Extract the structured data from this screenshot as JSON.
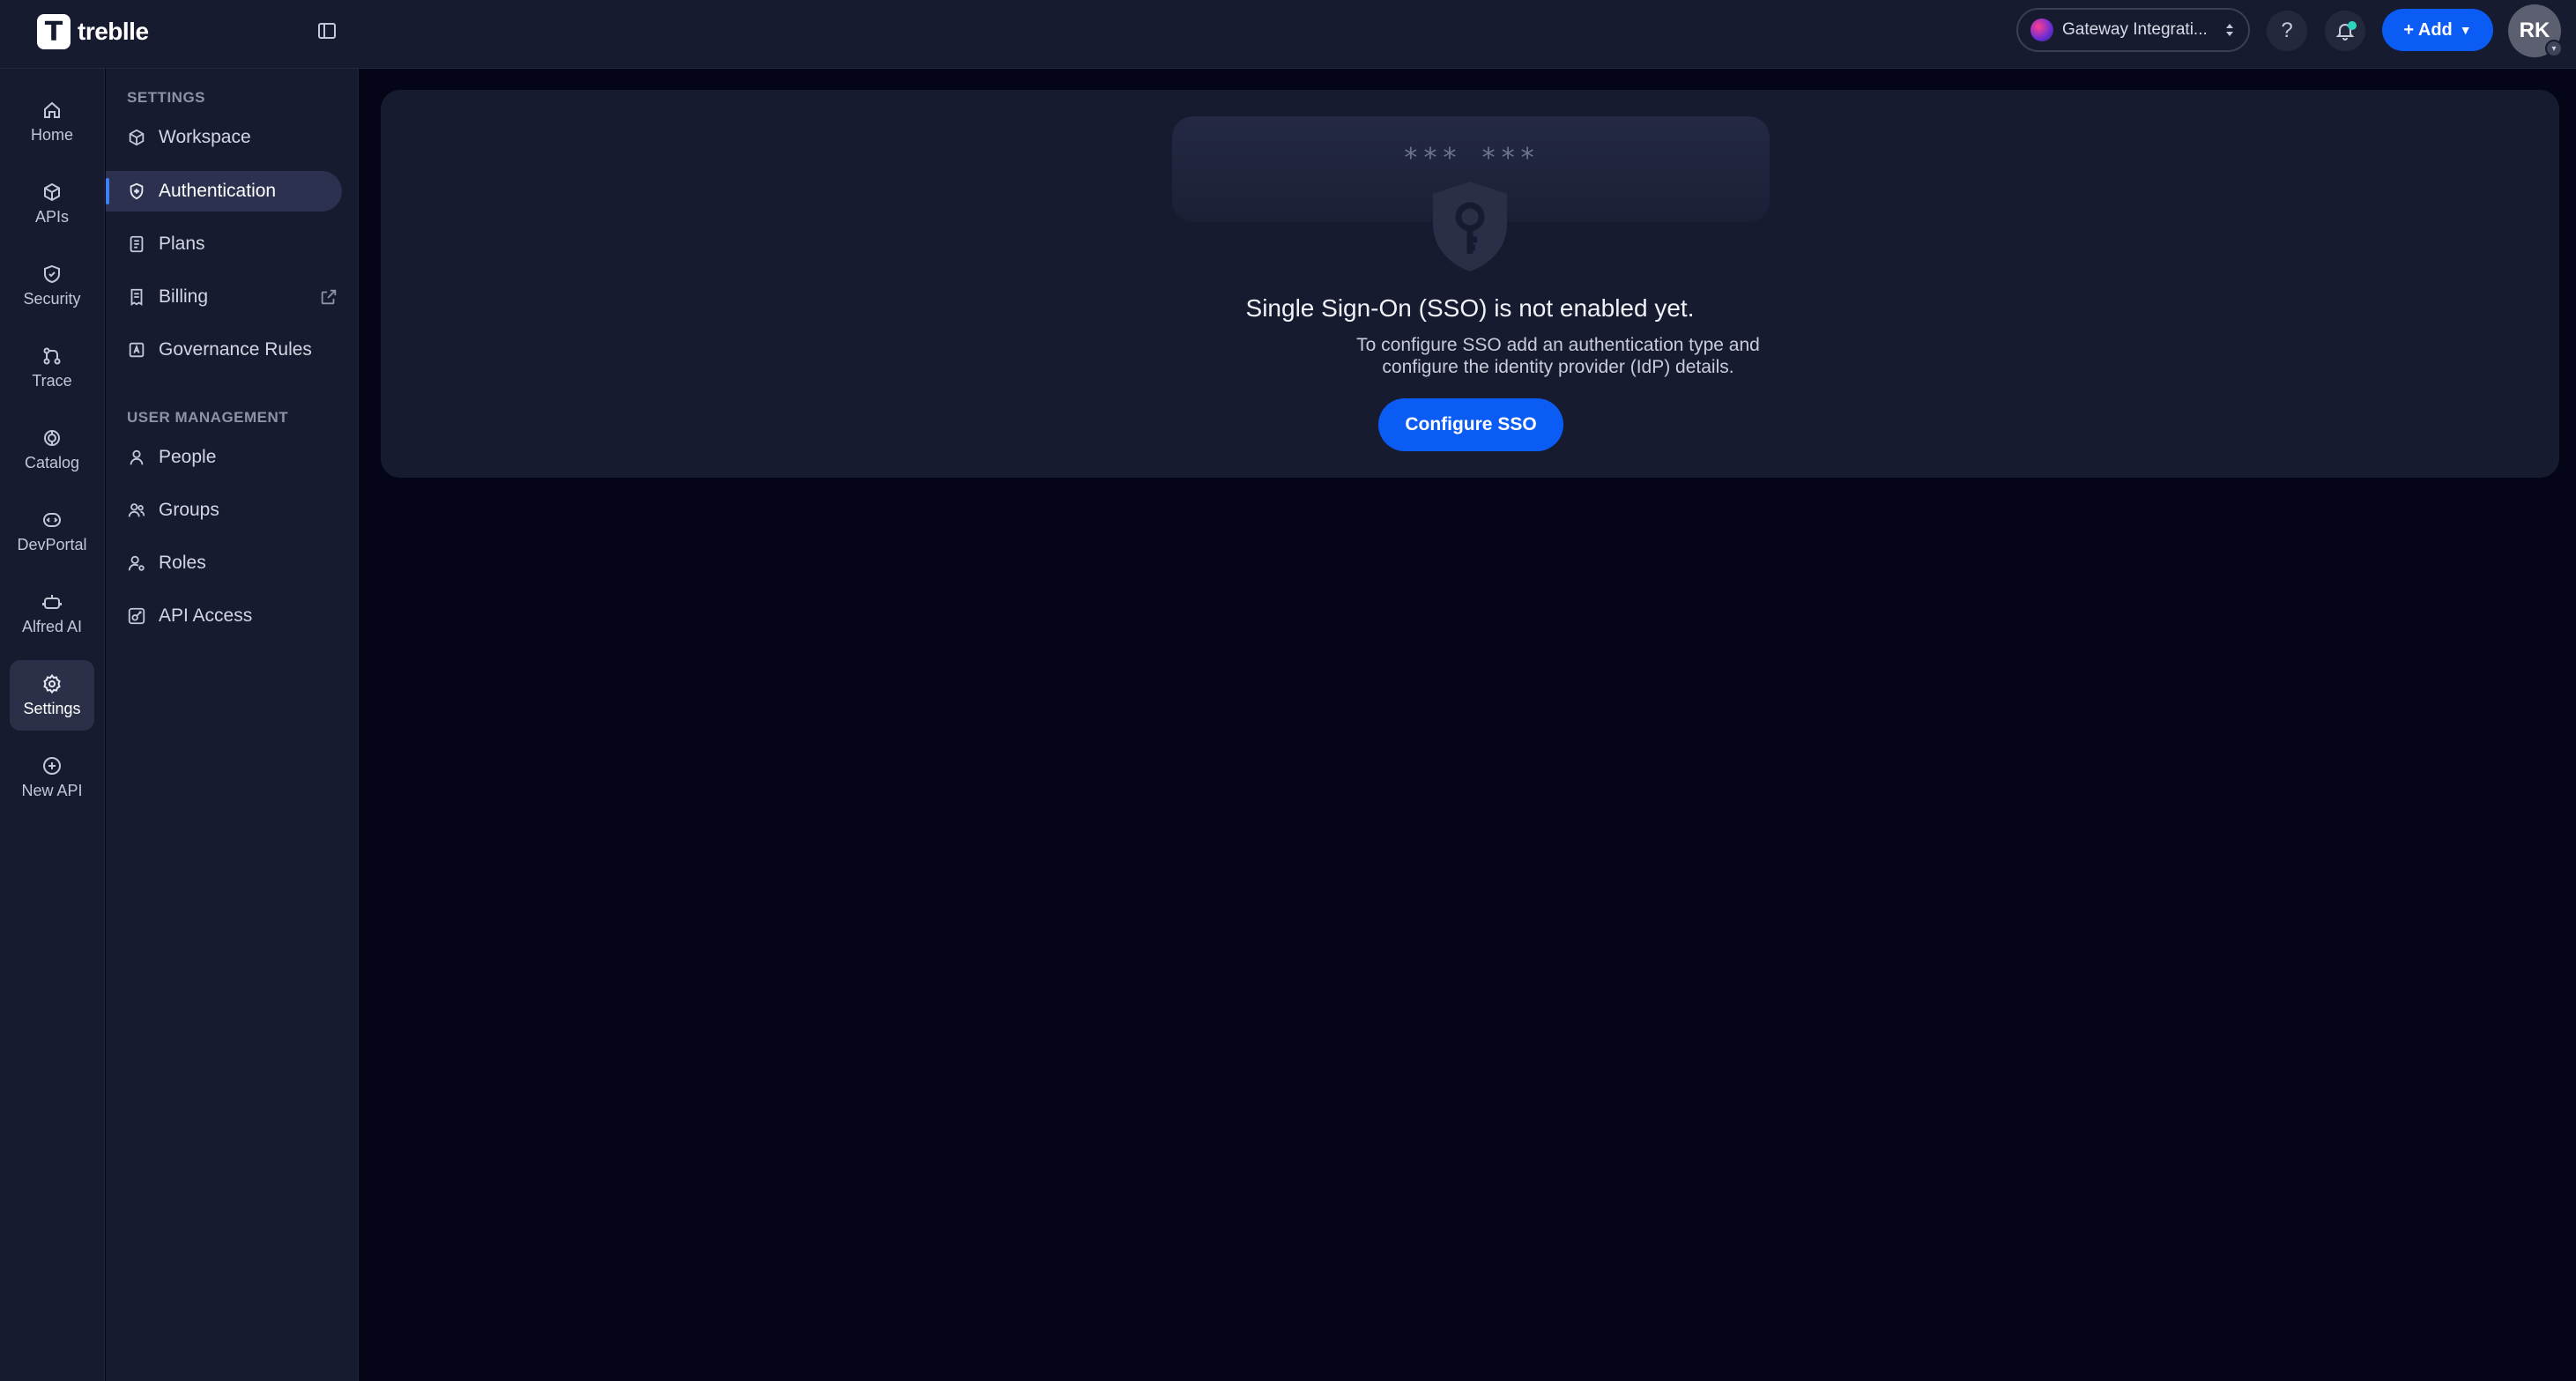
{
  "app": {
    "brand": "treblle"
  },
  "topbar": {
    "workspace_label": "Gateway Integrati...",
    "help_label": "?",
    "add_label": "+ Add",
    "avatar_initials": "RK"
  },
  "rail": {
    "items": [
      {
        "label": "Home",
        "icon": "home-icon"
      },
      {
        "label": "APIs",
        "icon": "cube-icon"
      },
      {
        "label": "Security",
        "icon": "shield-icon"
      },
      {
        "label": "Trace",
        "icon": "trace-icon"
      },
      {
        "label": "Catalog",
        "icon": "catalog-icon"
      },
      {
        "label": "DevPortal",
        "icon": "devportal-icon"
      },
      {
        "label": "Alfred AI",
        "icon": "robot-icon"
      },
      {
        "label": "Settings",
        "icon": "gear-icon",
        "active": true
      },
      {
        "label": "New API",
        "icon": "plus-circle-icon"
      }
    ]
  },
  "sidebar": {
    "settings_heading": "SETTINGS",
    "settings_items": [
      {
        "label": "Workspace",
        "icon": "cube-icon"
      },
      {
        "label": "Authentication",
        "icon": "fingerprint-icon",
        "active": true
      },
      {
        "label": "Plans",
        "icon": "document-icon"
      },
      {
        "label": "Billing",
        "icon": "receipt-icon",
        "external": true
      },
      {
        "label": "Governance Rules",
        "icon": "governance-icon"
      }
    ],
    "user_heading": "USER MANAGEMENT",
    "user_items": [
      {
        "label": "People",
        "icon": "user-icon"
      },
      {
        "label": "Groups",
        "icon": "users-icon"
      },
      {
        "label": "Roles",
        "icon": "user-gear-icon"
      },
      {
        "label": "API Access",
        "icon": "key-square-icon"
      }
    ]
  },
  "main": {
    "password_mask": "*** ***",
    "title": "Single Sign-On (SSO) is not enabled yet.",
    "description_line1": "To configure SSO add an authentication type and",
    "description_line2": "configure the identity provider (IdP) details.",
    "configure_button": "Configure SSO"
  },
  "colors": {
    "background": "#040617",
    "panel": "#171b30",
    "accent": "#0a5cf5",
    "active_item": "#2c3150"
  }
}
